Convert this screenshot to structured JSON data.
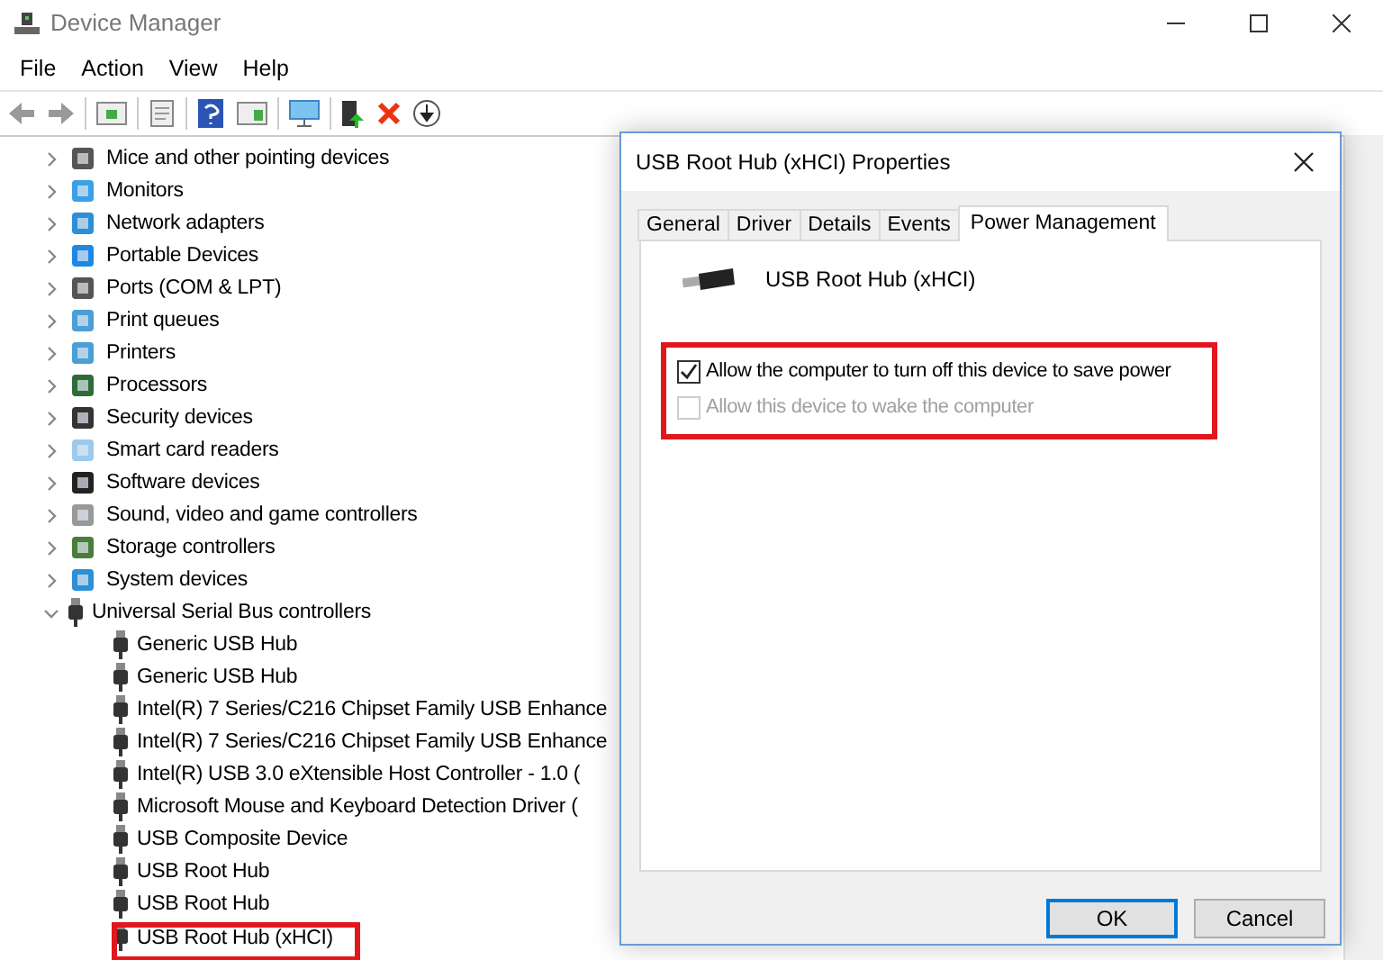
{
  "window": {
    "title": "Device Manager"
  },
  "menu": [
    "File",
    "Action",
    "View",
    "Help"
  ],
  "tree": [
    {
      "label": "Mice and other pointing devices",
      "expanded": false
    },
    {
      "label": "Monitors",
      "expanded": false
    },
    {
      "label": "Network adapters",
      "expanded": false
    },
    {
      "label": "Portable Devices",
      "expanded": false
    },
    {
      "label": "Ports (COM & LPT)",
      "expanded": false
    },
    {
      "label": "Print queues",
      "expanded": false
    },
    {
      "label": "Printers",
      "expanded": false
    },
    {
      "label": "Processors",
      "expanded": false
    },
    {
      "label": "Security devices",
      "expanded": false
    },
    {
      "label": "Smart card readers",
      "expanded": false
    },
    {
      "label": "Software devices",
      "expanded": false
    },
    {
      "label": "Sound, video and game controllers",
      "expanded": false
    },
    {
      "label": "Storage controllers",
      "expanded": false
    },
    {
      "label": "System devices",
      "expanded": false
    },
    {
      "label": "Universal Serial Bus controllers",
      "expanded": true,
      "children": [
        {
          "label": "Generic USB Hub",
          "highlighted": false
        },
        {
          "label": "Generic USB Hub",
          "highlighted": false
        },
        {
          "label": "Intel(R) 7 Series/C216 Chipset Family USB Enhance",
          "highlighted": false
        },
        {
          "label": "Intel(R) 7 Series/C216 Chipset Family USB Enhance",
          "highlighted": false
        },
        {
          "label": "Intel(R) USB 3.0 eXtensible Host Controller - 1.0 (",
          "highlighted": false
        },
        {
          "label": "Microsoft Mouse and Keyboard Detection Driver (",
          "highlighted": false
        },
        {
          "label": "USB Composite Device",
          "highlighted": false
        },
        {
          "label": "USB Root Hub",
          "highlighted": false
        },
        {
          "label": "USB Root Hub",
          "highlighted": false
        },
        {
          "label": "USB Root Hub (xHCI)",
          "highlighted": true
        }
      ]
    }
  ],
  "dialog": {
    "title": "USB Root Hub (xHCI) Properties",
    "tabs": [
      {
        "label": "General",
        "selected": false
      },
      {
        "label": "Driver",
        "selected": false
      },
      {
        "label": "Details",
        "selected": false
      },
      {
        "label": "Events",
        "selected": false
      },
      {
        "label": "Power Management",
        "selected": true
      }
    ],
    "device_name": "USB Root Hub (xHCI)",
    "options_highlighted": true,
    "options": [
      {
        "label": "Allow the computer to turn off this device to save power",
        "checked": true,
        "disabled": false
      },
      {
        "label": "Allow this device to wake the computer",
        "checked": false,
        "disabled": true
      }
    ],
    "buttons": [
      {
        "label": "OK",
        "default": true
      },
      {
        "label": "Cancel",
        "default": false
      }
    ]
  }
}
